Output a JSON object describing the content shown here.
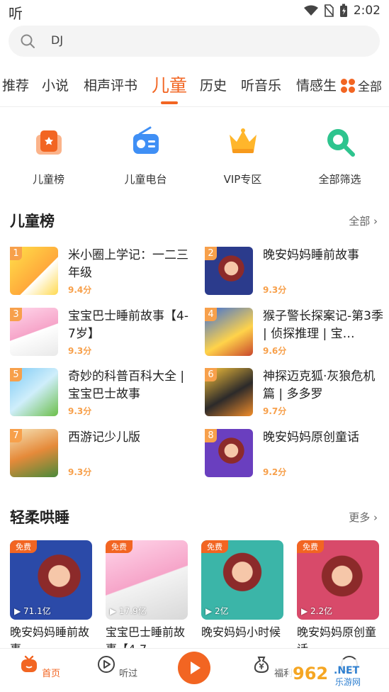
{
  "status": {
    "app_label": "听",
    "time": "2:02"
  },
  "search": {
    "value": "DJ"
  },
  "tabs": {
    "items": [
      "推荐",
      "小说",
      "相声评书",
      "儿童",
      "历史",
      "听音乐",
      "情感生"
    ],
    "active": "儿童",
    "all_label": "全部"
  },
  "quick": [
    {
      "icon": "chart-icon",
      "label": "儿童榜"
    },
    {
      "icon": "radio-icon",
      "label": "儿童电台"
    },
    {
      "icon": "crown-icon",
      "label": "VIP专区"
    },
    {
      "icon": "filter-search-icon",
      "label": "全部筛选"
    }
  ],
  "ranking": {
    "title": "儿童榜",
    "more": "全部",
    "items": [
      {
        "rank": "1",
        "title": "米小圈上学记：一二三年级",
        "score": "9.4分"
      },
      {
        "rank": "2",
        "title": "晚安妈妈睡前故事",
        "score": "9.3分"
      },
      {
        "rank": "3",
        "title": "宝宝巴士睡前故事【4-7岁】",
        "score": "9.3分"
      },
      {
        "rank": "4",
        "title": "猴子警长探案记-第3季 | 侦探推理 | 宝…",
        "score": "9.6分"
      },
      {
        "rank": "5",
        "title": "奇妙的科普百科大全 | 宝宝巴士故事",
        "score": "9.3分"
      },
      {
        "rank": "6",
        "title": "神探迈克狐·灰狼危机篇 | 多多罗",
        "score": "9.7分"
      },
      {
        "rank": "7",
        "title": "西游记少儿版",
        "score": "9.3分"
      },
      {
        "rank": "8",
        "title": "晚安妈妈原创童话",
        "score": "9.2分"
      }
    ]
  },
  "sleep": {
    "title": "轻柔哄睡",
    "more": "更多",
    "items": [
      {
        "free": "免费",
        "plays": "71.1亿",
        "title": "晚安妈妈睡前故事"
      },
      {
        "free": "免费",
        "plays": "17.9亿",
        "title": "宝宝巴士睡前故事【4-7"
      },
      {
        "free": "免费",
        "plays": "2亿",
        "title": "晚安妈妈小时候"
      },
      {
        "free": "免费",
        "plays": "2.2亿",
        "title": "晚安妈妈原创童话"
      }
    ]
  },
  "nav": {
    "home": "首页",
    "history": "听过",
    "welfare": "福利"
  },
  "colors": {
    "accent": "#f26522",
    "score": "#f7a04b"
  }
}
